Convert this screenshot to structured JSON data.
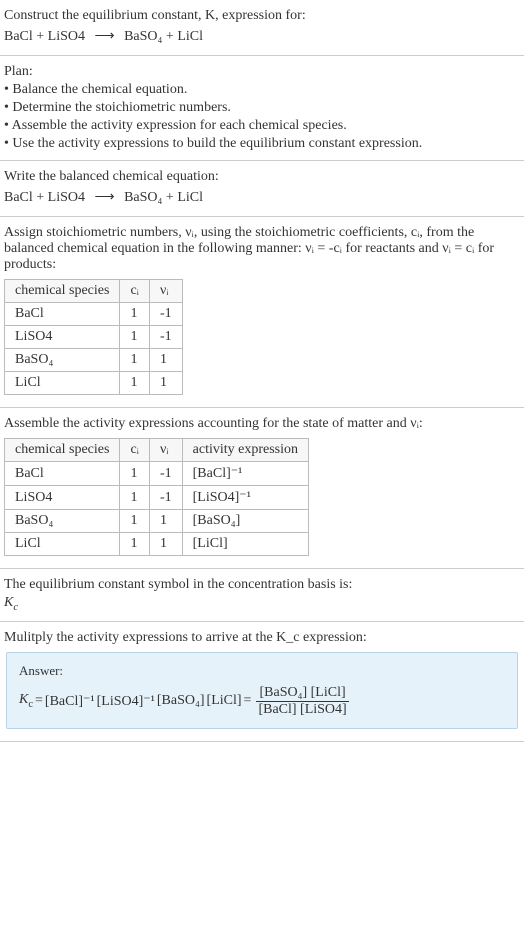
{
  "prompt": {
    "line1": "Construct the equilibrium constant, K, expression for:",
    "reaction_lhs": "BaCl + LiSO4",
    "reaction_arrow": "⟶",
    "reaction_rhs": "BaSO₄ + LiCl"
  },
  "plan": {
    "heading": "Plan:",
    "b1": "• Balance the chemical equation.",
    "b2": "• Determine the stoichiometric numbers.",
    "b3": "• Assemble the activity expression for each chemical species.",
    "b4": "• Use the activity expressions to build the equilibrium constant expression."
  },
  "balanced": {
    "heading": "Write the balanced chemical equation:",
    "reaction_lhs": "BaCl + LiSO4",
    "reaction_arrow": "⟶",
    "reaction_rhs": "BaSO₄ + LiCl"
  },
  "stoich": {
    "intro1": "Assign stoichiometric numbers, νᵢ, using the stoichiometric coefficients, cᵢ, from the balanced chemical equation in the following manner: νᵢ = -cᵢ for reactants and νᵢ = cᵢ for products:",
    "headers": {
      "species": "chemical species",
      "ci": "cᵢ",
      "vi": "νᵢ"
    },
    "rows": [
      {
        "species": "BaCl",
        "ci": "1",
        "vi": "-1"
      },
      {
        "species": "LiSO4",
        "ci": "1",
        "vi": "-1"
      },
      {
        "species": "BaSO₄",
        "ci": "1",
        "vi": "1"
      },
      {
        "species": "LiCl",
        "ci": "1",
        "vi": "1"
      }
    ]
  },
  "activity": {
    "intro": "Assemble the activity expressions accounting for the state of matter and νᵢ:",
    "headers": {
      "species": "chemical species",
      "ci": "cᵢ",
      "vi": "νᵢ",
      "expr": "activity expression"
    },
    "rows": [
      {
        "species": "BaCl",
        "ci": "1",
        "vi": "-1",
        "expr": "[BaCl]⁻¹"
      },
      {
        "species": "LiSO4",
        "ci": "1",
        "vi": "-1",
        "expr": "[LiSO4]⁻¹"
      },
      {
        "species": "BaSO₄",
        "ci": "1",
        "vi": "1",
        "expr": "[BaSO₄]"
      },
      {
        "species": "LiCl",
        "ci": "1",
        "vi": "1",
        "expr": "[LiCl]"
      }
    ]
  },
  "symbol": {
    "line1": "The equilibrium constant symbol in the concentration basis is:",
    "sym": "K_c"
  },
  "multiply": {
    "line1": "Mulitply the activity expressions to arrive at the K_c expression:"
  },
  "answer": {
    "label": "Answer:",
    "kc": "K_c",
    "eq": "=",
    "term1": "[BaCl]⁻¹",
    "term2": "[LiSO4]⁻¹",
    "term3": "[BaSO₄]",
    "term4": "[LiCl]",
    "frac_num": "[BaSO₄] [LiCl]",
    "frac_den": "[BaCl] [LiSO4]"
  },
  "chart_data": {
    "type": "table",
    "tables": [
      {
        "title": "Stoichiometric numbers",
        "columns": [
          "chemical species",
          "c_i",
          "ν_i"
        ],
        "rows": [
          [
            "BaCl",
            1,
            -1
          ],
          [
            "LiSO4",
            1,
            -1
          ],
          [
            "BaSO4",
            1,
            1
          ],
          [
            "LiCl",
            1,
            1
          ]
        ]
      },
      {
        "title": "Activity expressions",
        "columns": [
          "chemical species",
          "c_i",
          "ν_i",
          "activity expression"
        ],
        "rows": [
          [
            "BaCl",
            1,
            -1,
            "[BaCl]^-1"
          ],
          [
            "LiSO4",
            1,
            -1,
            "[LiSO4]^-1"
          ],
          [
            "BaSO4",
            1,
            1,
            "[BaSO4]"
          ],
          [
            "LiCl",
            1,
            1,
            "[LiCl]"
          ]
        ]
      }
    ],
    "equilibrium_expression": "K_c = [BaSO4][LiCl] / ([BaCl][LiSO4])"
  }
}
